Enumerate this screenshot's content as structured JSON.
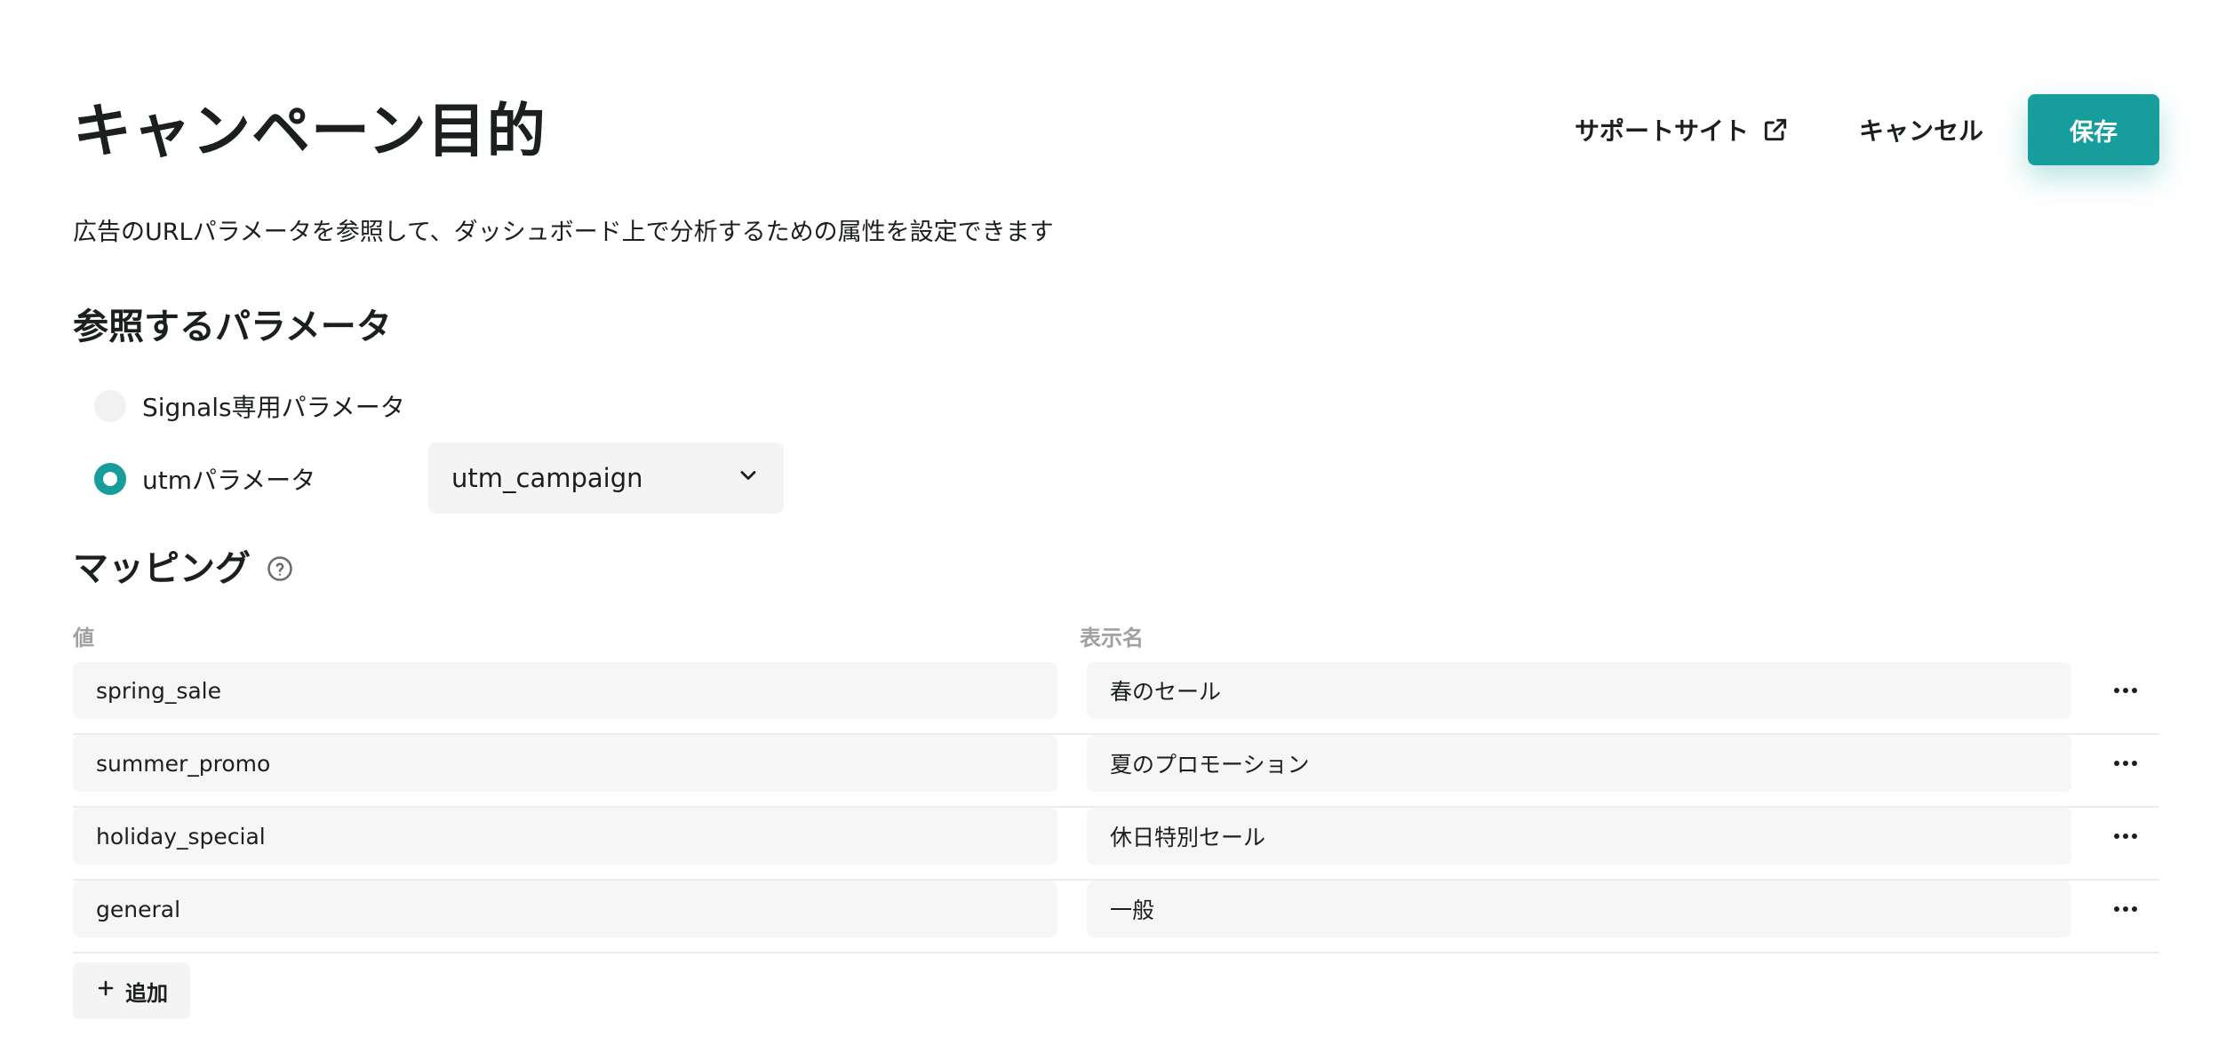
{
  "header": {
    "title": "キャンペーン目的",
    "support_label": "サポートサイト",
    "cancel_label": "キャンセル",
    "save_label": "保存"
  },
  "subtitle": "広告のURLパラメータを参照して、ダッシュボード上で分析するための属性を設定できます",
  "params_section": {
    "title": "参照するパラメータ",
    "options": [
      {
        "label": "Signals専用パラメータ",
        "selected": false
      },
      {
        "label": "utmパラメータ",
        "selected": true
      }
    ],
    "select_value": "utm_campaign"
  },
  "mapping_section": {
    "title": "マッピング",
    "col_value": "値",
    "col_display": "表示名",
    "rows": [
      {
        "value": "spring_sale",
        "display": "春のセール"
      },
      {
        "value": "summer_promo",
        "display": "夏のプロモーション"
      },
      {
        "value": "holiday_special",
        "display": "休日特別セール"
      },
      {
        "value": "general",
        "display": "一般"
      }
    ],
    "add_label": "追加"
  },
  "colors": {
    "accent": "#179e9c",
    "text": "#1b1f1f",
    "muted": "#a0a0a0",
    "field_bg": "#f6f6f6"
  }
}
